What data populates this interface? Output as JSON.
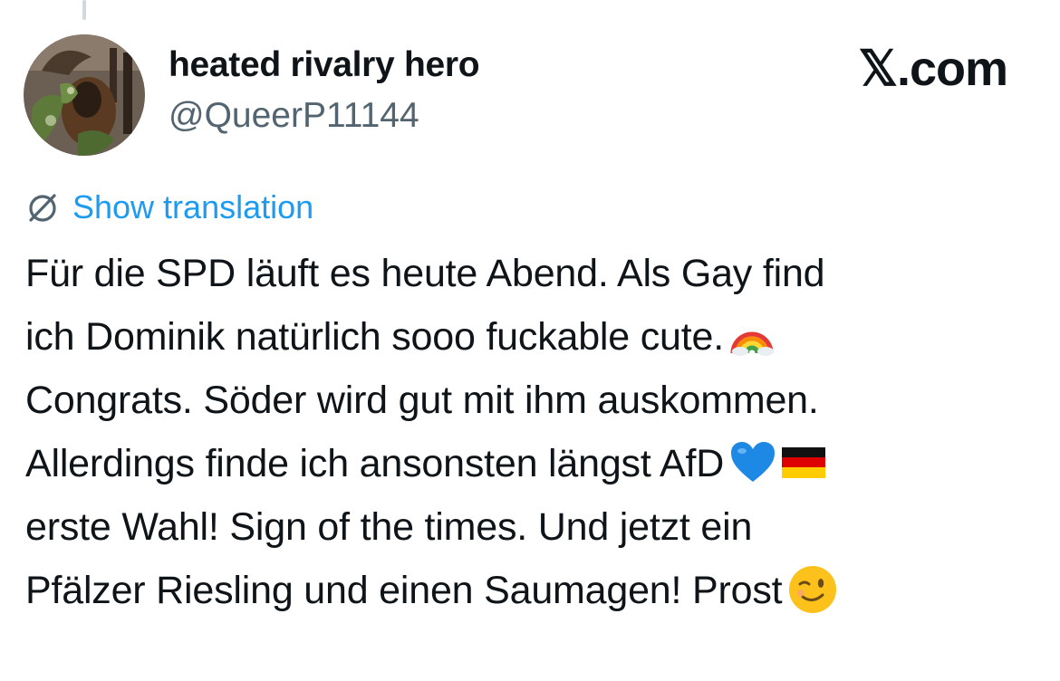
{
  "header": {
    "display_name": "heated rivalry hero",
    "handle": "@QueerP11144",
    "brand": "𝕏.com"
  },
  "translation": {
    "icon": "globe-icon",
    "label": "Show translation",
    "color": "#1d9bf0"
  },
  "tweet": {
    "lines": [
      "Für die SPD läuft es heute Abend. Als Gay find",
      "ich Dominik natürlich sooo fuckable cute.",
      "Congrats. Söder wird gut mit ihm auskommen.",
      "Allerdings finde ich ansonsten längst AfD",
      "erste Wahl! Sign of the times. Und jetzt ein",
      "Pfälzer Riesling und einen Saumagen! Prost"
    ],
    "emojis": [
      "rainbow-emoji",
      "blue-heart-emoji",
      "germany-flag-emoji",
      "winking-face-emoji"
    ]
  },
  "colors": {
    "text": "#0f1419",
    "secondary": "#536471",
    "accent": "#1d9bf0"
  }
}
